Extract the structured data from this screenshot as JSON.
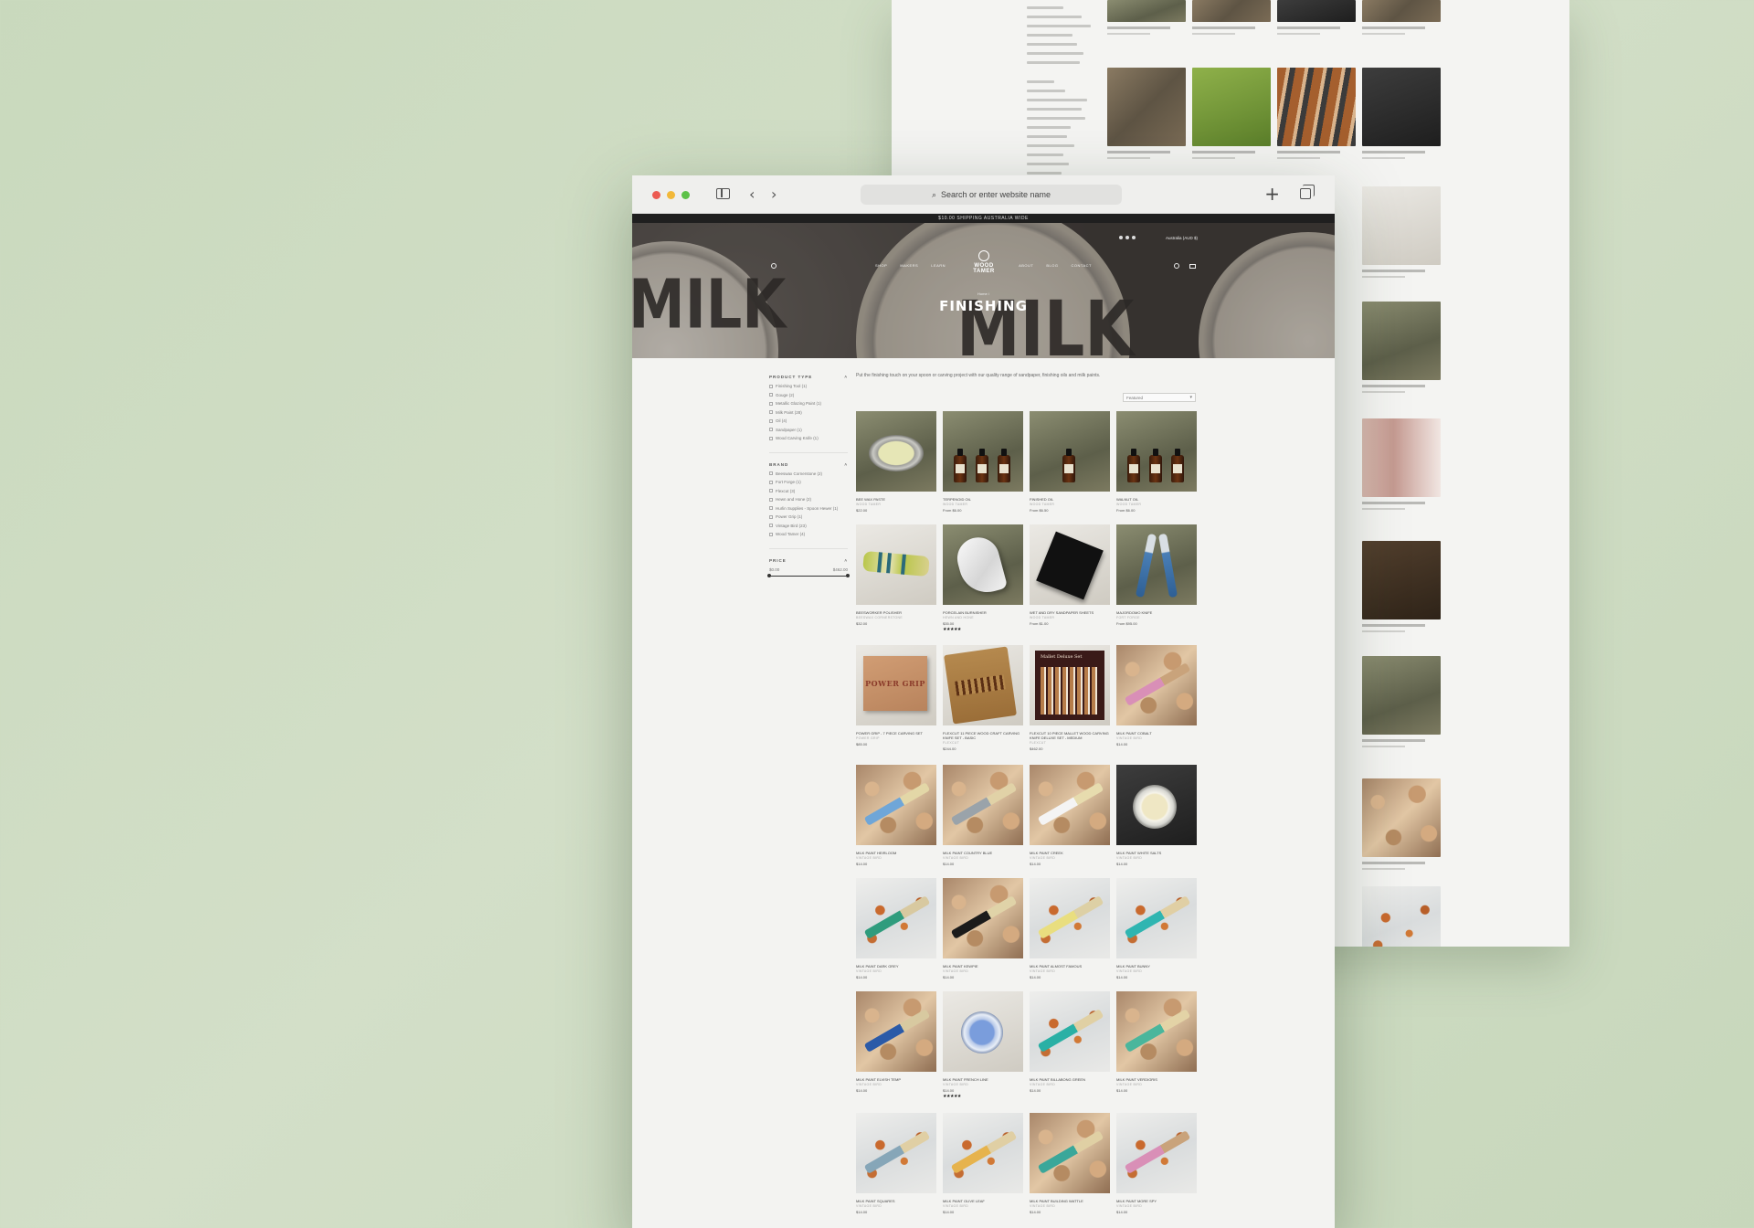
{
  "browser": {
    "address_placeholder": "Search or enter website name"
  },
  "site": {
    "announcement": "$10.00 SHIPPING AUSTRALIA WIDE",
    "logo_text": "WOOD TAMER",
    "nav": [
      "SHOP",
      "MAKERS",
      "LEARN",
      "ABOUT",
      "BLOG",
      "CONTACT"
    ],
    "region": "Australia (AUD $)",
    "breadcrumb": "Home /",
    "page_title": "FINISHING",
    "description": "Put the finishing touch on your spoon or carving project with our quality range of sandpaper, finishing oils and milk paints.",
    "sort_value": "Featured"
  },
  "filters": {
    "product_type": {
      "title": "PRODUCT TYPE",
      "items": [
        "Finishing Tool (1)",
        "Gouge (2)",
        "Metallic Glazing Paint (1)",
        "Milk Paint (28)",
        "Oil (4)",
        "Sandpaper (1)",
        "Wood Carving Knife (1)"
      ]
    },
    "brand": {
      "title": "BRAND",
      "items": [
        "Beeswax Cornerstone (2)",
        "Fort Forge (1)",
        "Flexcut (3)",
        "Hewn and Hone (2)",
        "Hurlin Supplies - Spoon Hewer (1)",
        "Power Grip (1)",
        "Vintage Bird (23)",
        "Wood Tamer (4)"
      ]
    },
    "price": {
      "title": "PRICE",
      "min": "$0.00",
      "max": "$462.00"
    }
  },
  "products": [
    {
      "name": "BEE WAX PASTE",
      "vendor": "WOOD TAMER",
      "price": "$22.00",
      "stars": ""
    },
    {
      "name": "TERPENOID OIL",
      "vendor": "WOOD TAMER",
      "price": "From $6.00",
      "stars": ""
    },
    {
      "name": "FINISHED OIL",
      "vendor": "WOOD TAMER",
      "price": "From $6.50",
      "stars": ""
    },
    {
      "name": "WALNUT OIL",
      "vendor": "WOOD TAMER",
      "price": "From $6.00",
      "stars": ""
    },
    {
      "name": "BEESWORKER POLISHER",
      "vendor": "BEESWAX CORNERSTONE",
      "price": "$32.00",
      "stars": ""
    },
    {
      "name": "PORCELAIN BURNISHER",
      "vendor": "HEWN AND HONE",
      "price": "$35.00",
      "stars": "★★★★★"
    },
    {
      "name": "WET AND DRY SANDPAPER SHEETS",
      "vendor": "WOOD TAMER",
      "price": "From $1.00",
      "stars": ""
    },
    {
      "name": "MAJORDOMO KNIFE",
      "vendor": "FORT FORGE",
      "price": "From $95.00",
      "stars": ""
    },
    {
      "name": "POWER GRIP - 7 PIECE CARVING SET",
      "vendor": "POWER GRIP",
      "price": "$85.00",
      "stars": ""
    },
    {
      "name": "FLEXCUT 11 PIECE WOOD CRAFT CARVING KNIFE SET - BASIC",
      "vendor": "FLEXCUT",
      "price": "$244.00",
      "stars": ""
    },
    {
      "name": "FLEXCUT 10 PIECE MALLET WOOD CARVING KNIFE DELUXE SET - MEDIUM",
      "vendor": "FLEXCUT",
      "price": "$462.00",
      "stars": ""
    },
    {
      "name": "MILK PAINT COBALT",
      "vendor": "VINTAGE BIRD",
      "price": "$14.00",
      "stars": ""
    },
    {
      "name": "MILK PAINT HEIRLOOM",
      "vendor": "VINTAGE BIRD",
      "price": "$14.00",
      "stars": ""
    },
    {
      "name": "MILK PAINT COUNTRY BLUE",
      "vendor": "VINTAGE BIRD",
      "price": "$14.00",
      "stars": ""
    },
    {
      "name": "MILK PAINT CREEK",
      "vendor": "VINTAGE BIRD",
      "price": "$14.00",
      "stars": ""
    },
    {
      "name": "MILK PAINT WHITE SALTS",
      "vendor": "VINTAGE BIRD",
      "price": "$14.00",
      "stars": ""
    },
    {
      "name": "MILK PAINT DARK GREY",
      "vendor": "VINTAGE BIRD",
      "price": "$14.00",
      "stars": ""
    },
    {
      "name": "MILK PAINT KEWPIE",
      "vendor": "VINTAGE BIRD",
      "price": "$14.00",
      "stars": ""
    },
    {
      "name": "MILK PAINT ALMOST FAMOUS",
      "vendor": "VINTAGE BIRD",
      "price": "$14.00",
      "stars": ""
    },
    {
      "name": "MILK PAINT BUNNY",
      "vendor": "VINTAGE BIRD",
      "price": "$14.00",
      "stars": ""
    },
    {
      "name": "MILK PAINT ELVISH TEMP",
      "vendor": "VINTAGE BIRD",
      "price": "$14.00",
      "stars": ""
    },
    {
      "name": "MILK PAINT FRENCH LINE",
      "vendor": "VINTAGE BIRD",
      "price": "$14.00",
      "stars": "★★★★★"
    },
    {
      "name": "MILK PAINT BILLABONG GREEN",
      "vendor": "VINTAGE BIRD",
      "price": "$14.00",
      "stars": ""
    },
    {
      "name": "MILK PAINT VERDIGRIS",
      "vendor": "VINTAGE BIRD",
      "price": "$14.00",
      "stars": ""
    },
    {
      "name": "MILK PAINT SQUARES",
      "vendor": "VINTAGE BIRD",
      "price": "$14.00",
      "stars": ""
    },
    {
      "name": "MILK PAINT OLIVE LEAF",
      "vendor": "VINTAGE BIRD",
      "price": "$14.00",
      "stars": ""
    },
    {
      "name": "MILK PAINT BUILDING WATTLE",
      "vendor": "VINTAGE BIRD",
      "price": "$14.00",
      "stars": ""
    },
    {
      "name": "MILK PAINT MORE SPY",
      "vendor": "VINTAGE BIRD",
      "price": "$14.00",
      "stars": ""
    }
  ],
  "colors": {
    "background": "#cfdcc3",
    "page": "#f3f3f1",
    "traffic_red": "#ec5b52",
    "traffic_yellow": "#f2b839",
    "traffic_green": "#5cc148"
  }
}
